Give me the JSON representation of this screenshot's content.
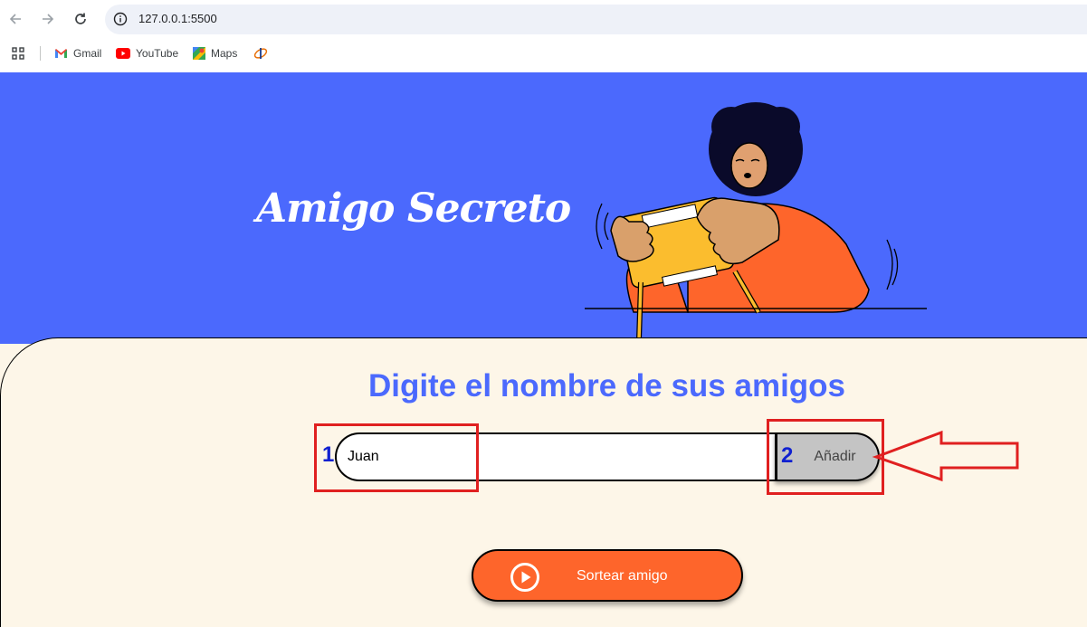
{
  "browser": {
    "url": "127.0.0.1:5500",
    "bookmarks": [
      {
        "label": "Gmail",
        "icon": "gmail-icon"
      },
      {
        "label": "YouTube",
        "icon": "youtube-icon"
      },
      {
        "label": "Maps",
        "icon": "maps-icon"
      },
      {
        "label": "",
        "icon": "bookmark-logo-icon"
      }
    ]
  },
  "header": {
    "title": "Amigo Secreto",
    "illustration": "person-playing-game-illustration"
  },
  "main": {
    "subtitle": "Digite el nombre de sus amigos",
    "name_input": {
      "value": "Juan"
    },
    "add_button": "Añadir",
    "draw_button": "Sortear amigo"
  },
  "annotations": {
    "label_1": "1",
    "label_2": "2"
  },
  "colors": {
    "banner": "#4b69fd",
    "background": "#fdf6e8",
    "accent_orange": "#fe652b",
    "annotation_red": "#e02020"
  }
}
